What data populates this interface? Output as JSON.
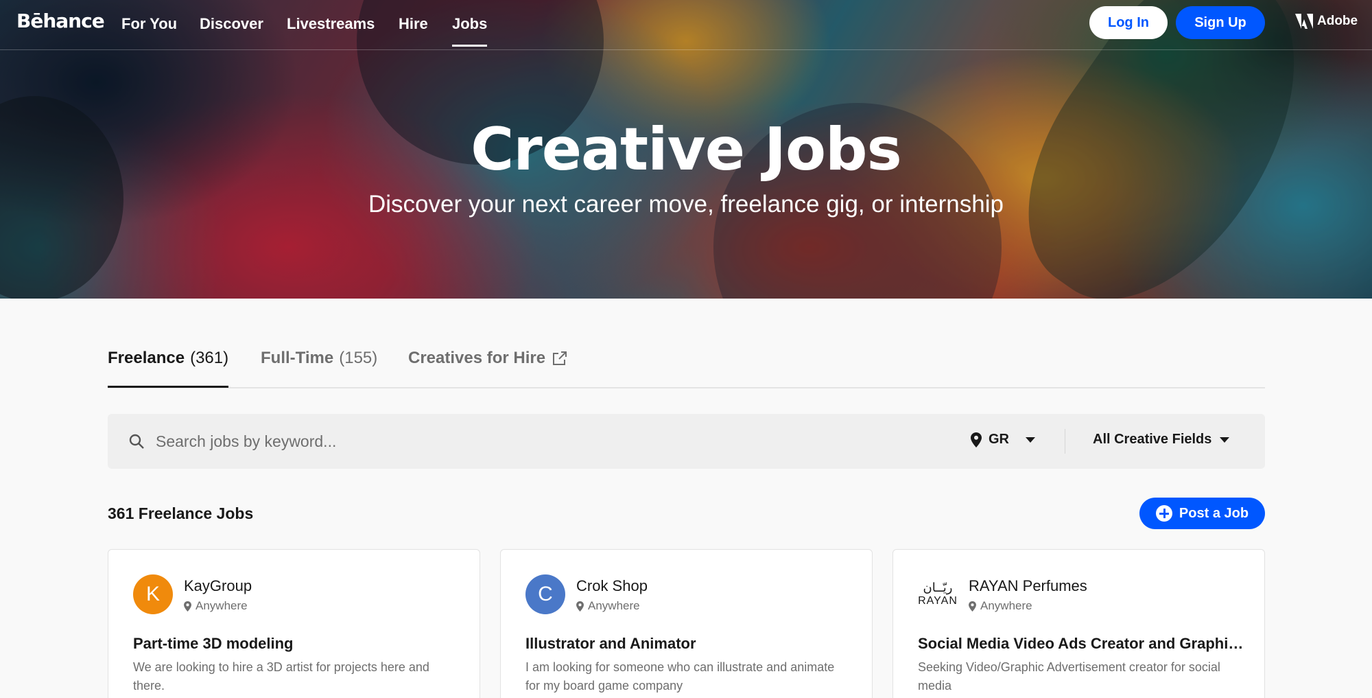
{
  "nav": {
    "logo": "Bēhance",
    "links": [
      "For You",
      "Discover",
      "Livestreams",
      "Hire",
      "Jobs"
    ],
    "active_link": "Jobs",
    "login_label": "Log In",
    "signup_label": "Sign Up",
    "adobe_label": "Adobe"
  },
  "hero": {
    "title": "Creative Jobs",
    "subtitle": "Discover your next career move, freelance gig, or internship"
  },
  "tabs": [
    {
      "label": "Freelance",
      "count": "(361)",
      "active": true
    },
    {
      "label": "Full-Time",
      "count": "(155)",
      "active": false
    },
    {
      "label": "Creatives for Hire",
      "count": "",
      "active": false
    }
  ],
  "search": {
    "placeholder": "Search jobs by keyword...",
    "location_value": "GR",
    "field_value": "All Creative Fields"
  },
  "results": {
    "count_label": "361 Freelance Jobs",
    "post_job_label": "Post a Job"
  },
  "jobs": [
    {
      "avatar_letter": "K",
      "avatar_color": "#f08a0c",
      "company": "KayGroup",
      "location": "Anywhere",
      "title": "Part-time 3D modeling",
      "description": "We are looking to hire a 3D artist for projects here and there."
    },
    {
      "avatar_letter": "C",
      "avatar_color": "#4a78c8",
      "company": "Crok Shop",
      "location": "Anywhere",
      "title": "Illustrator and Animator",
      "description": "I am looking for someone who can illustrate and animate for my board game company"
    },
    {
      "avatar_letter": "",
      "avatar_color": "#ffffff",
      "logo_arabic": "ريّــان",
      "logo_latin": "RAYAN",
      "company": "RAYAN Perfumes",
      "location": "Anywhere",
      "title": "Social Media Video Ads Creator and Graphic ...",
      "description": "Seeking Video/Graphic Advertisement creator for social media"
    }
  ],
  "colors": {
    "accent": "#0057ff",
    "text": "#191919",
    "muted": "#6e6e6e",
    "page_bg": "#f9f9f9"
  }
}
